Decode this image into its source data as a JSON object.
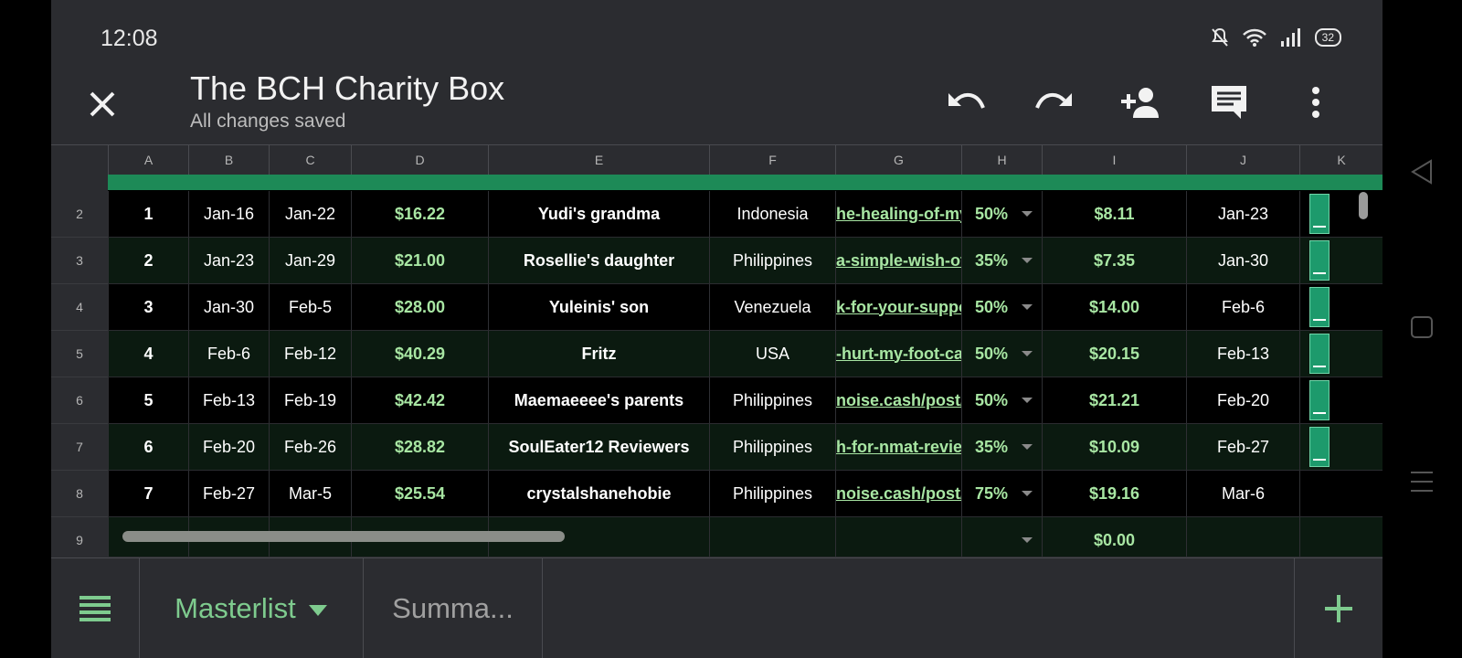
{
  "status_bar": {
    "time": "12:08",
    "battery": "32"
  },
  "header": {
    "title": "The BCH Charity Box",
    "subtitle": "All changes saved"
  },
  "columns": [
    "A",
    "B",
    "C",
    "D",
    "E",
    "F",
    "G",
    "H",
    "I",
    "J",
    "K"
  ],
  "row_numbers": [
    "2",
    "3",
    "4",
    "5",
    "6",
    "7",
    "8",
    "9"
  ],
  "rows": [
    {
      "a": "1",
      "b": "Jan-16",
      "c": "Jan-22",
      "d": "$16.22",
      "e": "Yudi's grandma",
      "f": "Indonesia",
      "g": "he-healing-of-my-",
      "h": "50%",
      "i": "$8.11",
      "j": "Jan-23"
    },
    {
      "a": "2",
      "b": "Jan-23",
      "c": "Jan-29",
      "d": "$21.00",
      "e": "Rosellie's daughter",
      "f": "Philippines",
      "g": "a-simple-wish-of",
      "h": "35%",
      "i": "$7.35",
      "j": "Jan-30"
    },
    {
      "a": "3",
      "b": "Jan-30",
      "c": "Feb-5",
      "d": "$28.00",
      "e": "Yuleinis' son",
      "f": "Venezuela",
      "g": "k-for-your-suppo",
      "h": "50%",
      "i": "$14.00",
      "j": "Feb-6"
    },
    {
      "a": "4",
      "b": "Feb-6",
      "c": "Feb-12",
      "d": "$40.29",
      "e": "Fritz",
      "f": "USA",
      "g": "-hurt-my-foot-ca",
      "h": "50%",
      "i": "$20.15",
      "j": "Feb-13"
    },
    {
      "a": "5",
      "b": "Feb-13",
      "c": "Feb-19",
      "d": "$42.42",
      "e": "Maemaeeee's parents",
      "f": "Philippines",
      "g": "noise.cash/post/l",
      "h": "50%",
      "i": "$21.21",
      "j": "Feb-20"
    },
    {
      "a": "6",
      "b": "Feb-20",
      "c": "Feb-26",
      "d": "$28.82",
      "e": "SoulEater12 Reviewers",
      "f": "Philippines",
      "g": "h-for-nmat-review",
      "h": "35%",
      "i": "$10.09",
      "j": "Feb-27"
    },
    {
      "a": "7",
      "b": "Feb-27",
      "c": "Mar-5",
      "d": "$25.54",
      "e": "crystalshanehobie",
      "f": "Philippines",
      "g": "noise.cash/post/l",
      "h": "75%",
      "i": "$19.16",
      "j": "Mar-6"
    },
    {
      "a": "",
      "b": "",
      "c": "",
      "d": "",
      "e": "",
      "f": "",
      "g": "",
      "h": "",
      "i": "$0.00",
      "j": ""
    }
  ],
  "tabs": [
    {
      "label": "Masterlist",
      "active": true
    },
    {
      "label": "Summa...",
      "active": false
    }
  ],
  "colors": {
    "accent": "#7ecb8e",
    "band": "#1d8a57",
    "money": "#a8e6a3"
  }
}
